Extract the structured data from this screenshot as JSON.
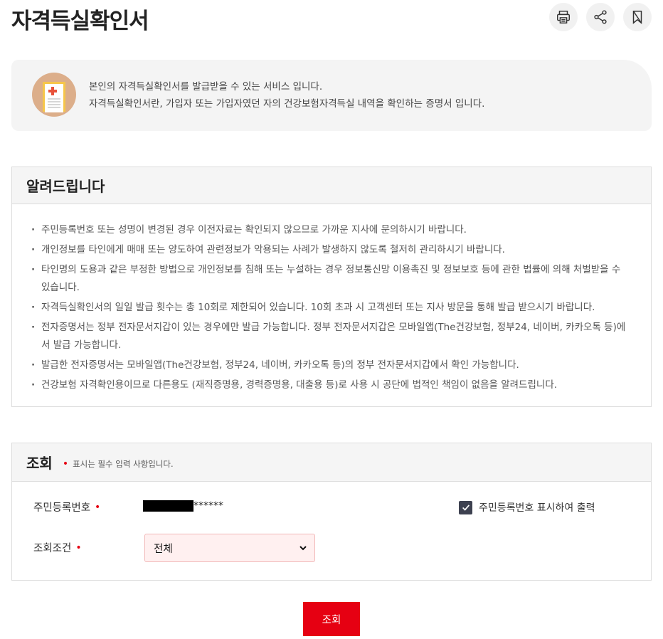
{
  "header": {
    "title": "자격득실확인서",
    "actions": [
      {
        "name": "print",
        "icon": "printer-icon"
      },
      {
        "name": "share",
        "icon": "share-icon"
      },
      {
        "name": "bookmark",
        "icon": "bookmark-icon"
      }
    ]
  },
  "intro": {
    "icon": "document-icon",
    "line1": "본인의 자격득실확인서를 발급받을 수 있는 서비스 입니다.",
    "line2": "자격득실확인서란, 가입자 또는 가입자였던 자의 건강보험자격득실 내역을 확인하는 증명서 입니다."
  },
  "notice": {
    "title": "알려드립니다",
    "items": [
      "주민등록번호 또는 성명이 변경된 경우 이전자료는 확인되지 않으므로 가까운 지사에 문의하시기 바랍니다.",
      "개인정보를 타인에게 매매 또는 양도하여 관련정보가 악용되는 사례가 발생하지 않도록 철저히 관리하시기 바랍니다.",
      "타인명의 도용과 같은 부정한 방법으로 개인정보를 침해 또는 누설하는 경우 정보통신망 이용촉진 및 정보보호 등에 관한 법률에 의해 처벌받을 수 있습니다.",
      "자격득실확인서의 일일 발급 횟수는 총 10회로 제한되어 있습니다. 10회 초과 시 고객센터 또는 지사 방문을 통해 발급 받으시기 바랍니다.",
      "전자증명서는 정부 전자문서지갑이 있는 경우에만 발급 가능합니다. 정부 전자문서지갑은 모바일앱(The건강보험, 정부24, 네이버, 카카오톡 등)에서 발급 가능합니다.",
      "발급한 전자증명서는 모바일앱(The건강보험, 정부24, 네이버, 카카오톡 등)의 정부 전자문서지갑에서 확인 가능합니다.",
      "건강보험 자격확인용이므로 다른용도 (재직증명용, 경력증명용, 대출용 등)로 사용 시 공단에 법적인 책임이 없음을 알려드립니다."
    ]
  },
  "query": {
    "title": "조회",
    "required_note": "표시는 필수 입력 사항입니다.",
    "rrn_label": "주민등록번호",
    "rrn_suffix": "******",
    "print_rrn_label": "주민등록번호 표시하여 출력",
    "print_rrn_checked": true,
    "condition_label": "조회조건",
    "condition_value": "전체",
    "submit_label": "조회"
  },
  "colors": {
    "accent": "#e60012",
    "checkbox": "#3d4150",
    "panel_bg": "#f5f5f5"
  }
}
